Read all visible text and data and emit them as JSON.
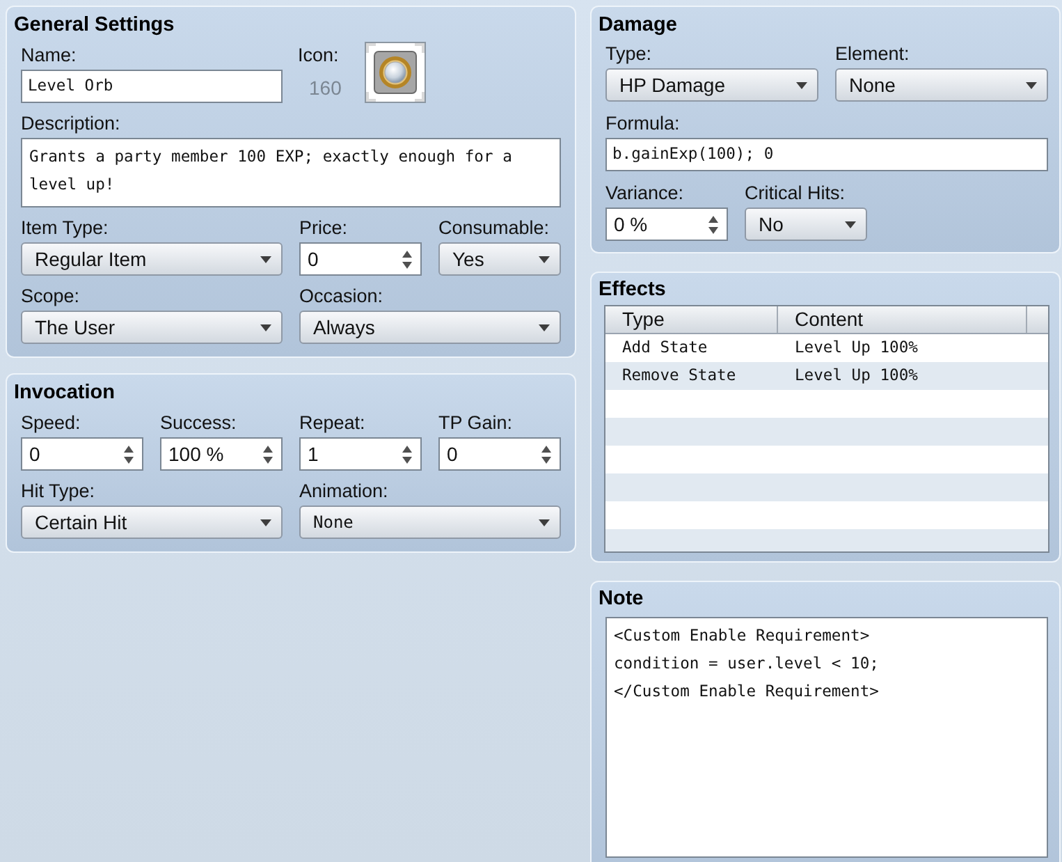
{
  "general_settings": {
    "title": "General Settings",
    "name": {
      "label": "Name:",
      "kind": "text",
      "value": "Level Orb"
    },
    "icon": {
      "label": "Icon:",
      "number": "160"
    },
    "description": {
      "label": "Description:",
      "kind": "textarea",
      "value": "Grants a party member 100 EXP; exactly enough for a level up!"
    },
    "item_type": {
      "label": "Item Type:",
      "kind": "dropdown",
      "value": "Regular Item"
    },
    "price": {
      "label": "Price:",
      "kind": "spinner",
      "value": "0"
    },
    "consumable": {
      "label": "Consumable:",
      "kind": "dropdown",
      "value": "Yes"
    },
    "scope": {
      "label": "Scope:",
      "kind": "dropdown",
      "value": "The User"
    },
    "occasion": {
      "label": "Occasion:",
      "kind": "dropdown",
      "value": "Always"
    }
  },
  "invocation": {
    "title": "Invocation",
    "speed": {
      "label": "Speed:",
      "kind": "spinner",
      "value": "0"
    },
    "success": {
      "label": "Success:",
      "kind": "spinner",
      "value": "100 %"
    },
    "repeat": {
      "label": "Repeat:",
      "kind": "spinner",
      "value": "1"
    },
    "tp_gain": {
      "label": "TP Gain:",
      "kind": "spinner",
      "value": "0"
    },
    "hit_type": {
      "label": "Hit Type:",
      "kind": "dropdown",
      "value": "Certain Hit"
    },
    "animation": {
      "label": "Animation:",
      "kind": "dropdown",
      "value": "None"
    }
  },
  "damage": {
    "title": "Damage",
    "type": {
      "label": "Type:",
      "kind": "dropdown",
      "value": "HP Damage"
    },
    "element": {
      "label": "Element:",
      "kind": "dropdown",
      "value": "None"
    },
    "formula": {
      "label": "Formula:",
      "kind": "text",
      "value": "b.gainExp(100); 0"
    },
    "variance": {
      "label": "Variance:",
      "kind": "spinner",
      "value": "0 %"
    },
    "critical_hits": {
      "label": "Critical Hits:",
      "kind": "dropdown",
      "value": "No"
    }
  },
  "effects": {
    "title": "Effects",
    "columns": [
      "Type",
      "Content"
    ],
    "rows": [
      {
        "cells": [
          "Add State",
          "Level Up 100%"
        ]
      },
      {
        "cells": [
          "Remove State",
          "Level Up 100%"
        ]
      }
    ]
  },
  "note": {
    "title": "Note",
    "value": "<Custom Enable Requirement>\ncondition = user.level < 10;\n</Custom Enable Requirement>"
  }
}
